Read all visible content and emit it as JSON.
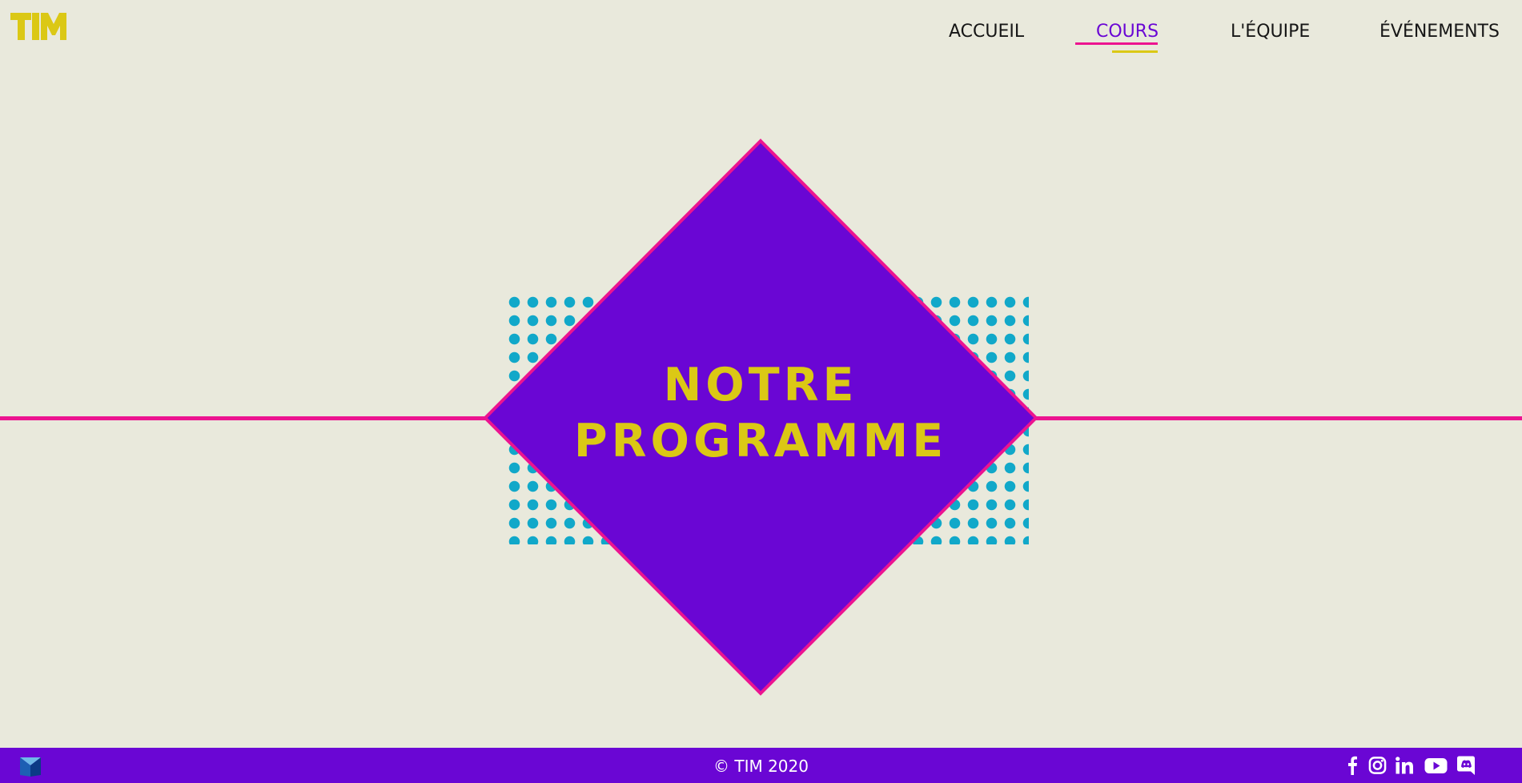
{
  "brand": {
    "logo_text": "TIM",
    "colors": {
      "background": "#e9e9dc",
      "purple": "#6a06d4",
      "pink": "#ec1490",
      "yellow": "#dbc815",
      "teal": "#11a8c9",
      "text": "#161616"
    }
  },
  "nav": {
    "items": [
      {
        "label": "ACCUEIL",
        "active": false
      },
      {
        "label": "COURS",
        "active": true
      },
      {
        "label": "L'ÉQUIPE",
        "active": false
      },
      {
        "label": "ÉVÉNEMENTS",
        "active": false
      }
    ]
  },
  "hero": {
    "title_line1": "NOTRE",
    "title_line2": "PROGRAMME"
  },
  "footer": {
    "copyright": "© TIM 2020",
    "logo_icon": "tim-cube-icon",
    "social_icons": [
      "facebook-icon",
      "instagram-icon",
      "linkedin-icon",
      "youtube-icon",
      "discord-icon"
    ]
  }
}
